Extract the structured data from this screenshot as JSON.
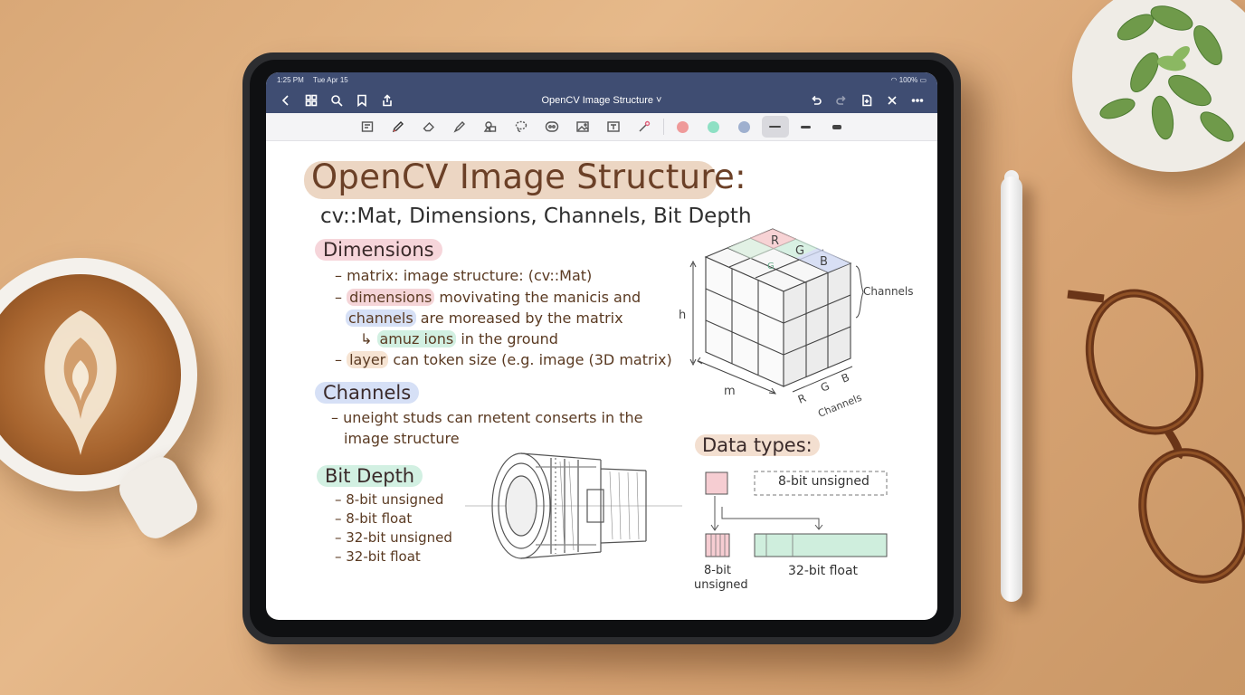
{
  "status_bar": {
    "time": "1:25 PM",
    "date": "Tue Apr 15",
    "battery": "100%"
  },
  "nav": {
    "title": "OpenCV Image Structure ˅"
  },
  "toolbar": {
    "tools": [
      "page-template",
      "pen",
      "eraser",
      "highlighter",
      "shapes",
      "lasso",
      "sticker",
      "image",
      "text",
      "laser-pointer"
    ],
    "colors": [
      "#ef9a9a",
      "#8ee0c4",
      "#9fb0cf"
    ]
  },
  "note": {
    "title": "OpenCV Image Structure:",
    "subtitle": "cv::Mat, Dimensions, Channels, Bit Depth",
    "dimensions": {
      "heading": "Dimensions",
      "line1": "– matrix: image structure: (cv::Mat)",
      "line2_pre": "– ",
      "line2_hl": "dimensions",
      "line2_post": " movivating the manicis and",
      "line3_hl": "channels",
      "line3_post": " are moreased by the matrix",
      "line4_arrow": "↳ ",
      "line4_hl": "amuz ions",
      "line4_post": " in the ground",
      "line5_pre": "– ",
      "line5_hl": "layer",
      "line5_post": " can token size (e.g. image (3D matrix)"
    },
    "channels": {
      "heading": "Channels",
      "line1": "– uneight studs can rnetent conserts in the",
      "line2": "image structure"
    },
    "bit_depth": {
      "heading": "Bit Depth",
      "items": [
        "– 8-bit unsigned",
        "– 8-bit float",
        "– 32-bit unsigned",
        "– 32-bit float"
      ]
    },
    "cube": {
      "top_labels": [
        "R",
        "G",
        "B"
      ],
      "top_mid": "G",
      "h": "h",
      "m": "m",
      "channels_right": "Channels",
      "bottom_labels": [
        "R",
        "G",
        "B"
      ],
      "channels_bottom": "Channels"
    },
    "data_types": {
      "heading": "Data types:",
      "box_label": "8-bit unsigned",
      "small_label_1": "8-bit",
      "small_label_2": "unsigned",
      "bar_label": "32-bit float"
    }
  }
}
